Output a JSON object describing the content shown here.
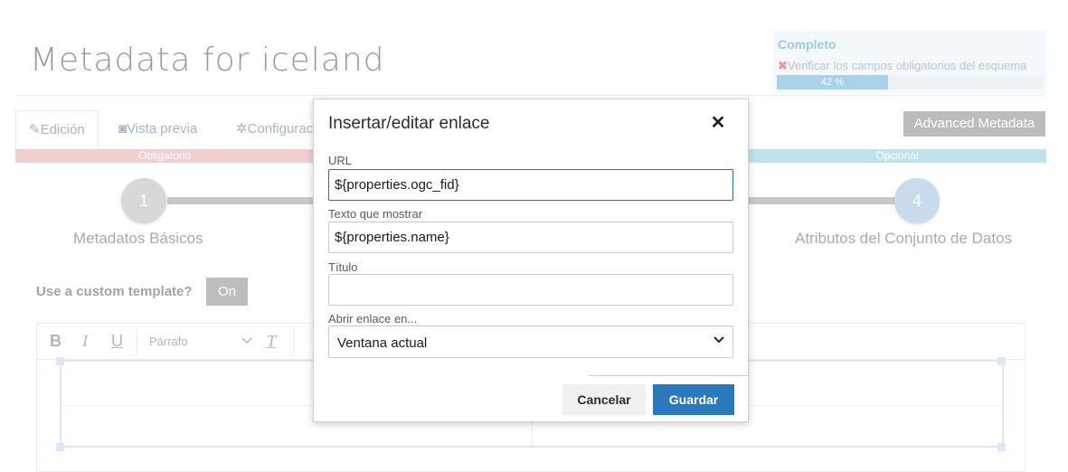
{
  "page": {
    "title": "Metadata for iceland"
  },
  "status": {
    "title": "Completo",
    "error_text": "Verificar los campos obligatorios del esquema",
    "progress_value": 42,
    "progress_text": "42 %"
  },
  "tabs": [
    {
      "label": "Edición",
      "icon": "pencil-icon"
    },
    {
      "label": "Vista previa",
      "icon": "camera-icon"
    },
    {
      "label": "Configurac",
      "icon": "gear-icon"
    }
  ],
  "advanced_button": "Advanced Metadata",
  "bands": {
    "required": "Obligatorio",
    "optional": "Opcional"
  },
  "steps": [
    {
      "number": "1",
      "label": "Metadatos Básicos"
    },
    {
      "number": "4",
      "label": "Atributos del Conjunto de Datos"
    }
  ],
  "custom_template": {
    "label": "Use a custom template?",
    "toggle": "On"
  },
  "editor": {
    "format_label": "Párrafo"
  },
  "modal": {
    "title": "Insertar/editar enlace",
    "url_label": "URL",
    "url_value": "${properties.ogc_fid}",
    "text_label": "Texto que mostrar",
    "text_value": "${properties.name}",
    "title_label": "Título",
    "title_value": "",
    "target_label": "Abrir enlace en...",
    "target_value": "Ventana actual",
    "cancel_label": "Cancelar",
    "save_label": "Guardar"
  },
  "colors": {
    "primary": "#2a79bd",
    "required_band": "#f2cfcf",
    "optional_band": "#bfe3ec",
    "step_1": "#d8d8d8",
    "step_4": "#c9dced"
  }
}
